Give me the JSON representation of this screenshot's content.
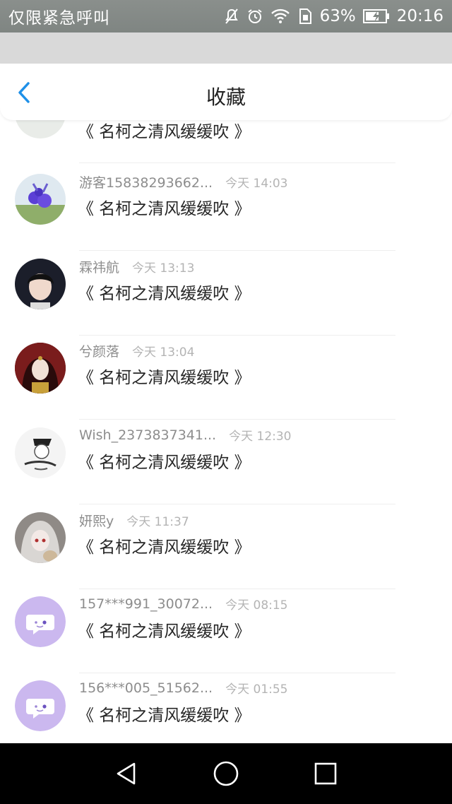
{
  "status_bar": {
    "carrier": "仅限紧急呼叫",
    "battery_percent": "63%",
    "time": "20:16"
  },
  "header": {
    "title": "收藏"
  },
  "favorites": [
    {
      "name": "",
      "time": "",
      "title": "《 名柯之清风缓缓吹 》",
      "avatar": "avatar-partial"
    },
    {
      "name": "游客15838293662...",
      "time": "今天 14:03",
      "title": "《 名柯之清风缓缓吹 》",
      "avatar": "avatar-flower"
    },
    {
      "name": "霖祎航",
      "time": "今天 13:13",
      "title": "《 名柯之清风缓缓吹 》",
      "avatar": "avatar-boy"
    },
    {
      "name": "兮颜落",
      "time": "今天 13:04",
      "title": "《 名柯之清风缓缓吹 》",
      "avatar": "avatar-girl-red"
    },
    {
      "name": "Wish_2373837341...",
      "time": "今天 12:30",
      "title": "《 名柯之清风缓缓吹 》",
      "avatar": "avatar-sketch"
    },
    {
      "name": "妍熙y",
      "time": "今天 11:37",
      "title": "《 名柯之清风缓缓吹 》",
      "avatar": "avatar-anime-grey"
    },
    {
      "name": "157***991_30072...",
      "time": "今天 08:15",
      "title": "《 名柯之清风缓缓吹 》",
      "avatar": "avatar-default-chat"
    },
    {
      "name": "156***005_51562...",
      "time": "今天 01:55",
      "title": "《 名柯之清风缓缓吹 》",
      "avatar": "avatar-default-chat"
    }
  ],
  "colors": {
    "accent": "#1e90e8",
    "default_avatar": "#cbb8ef"
  }
}
